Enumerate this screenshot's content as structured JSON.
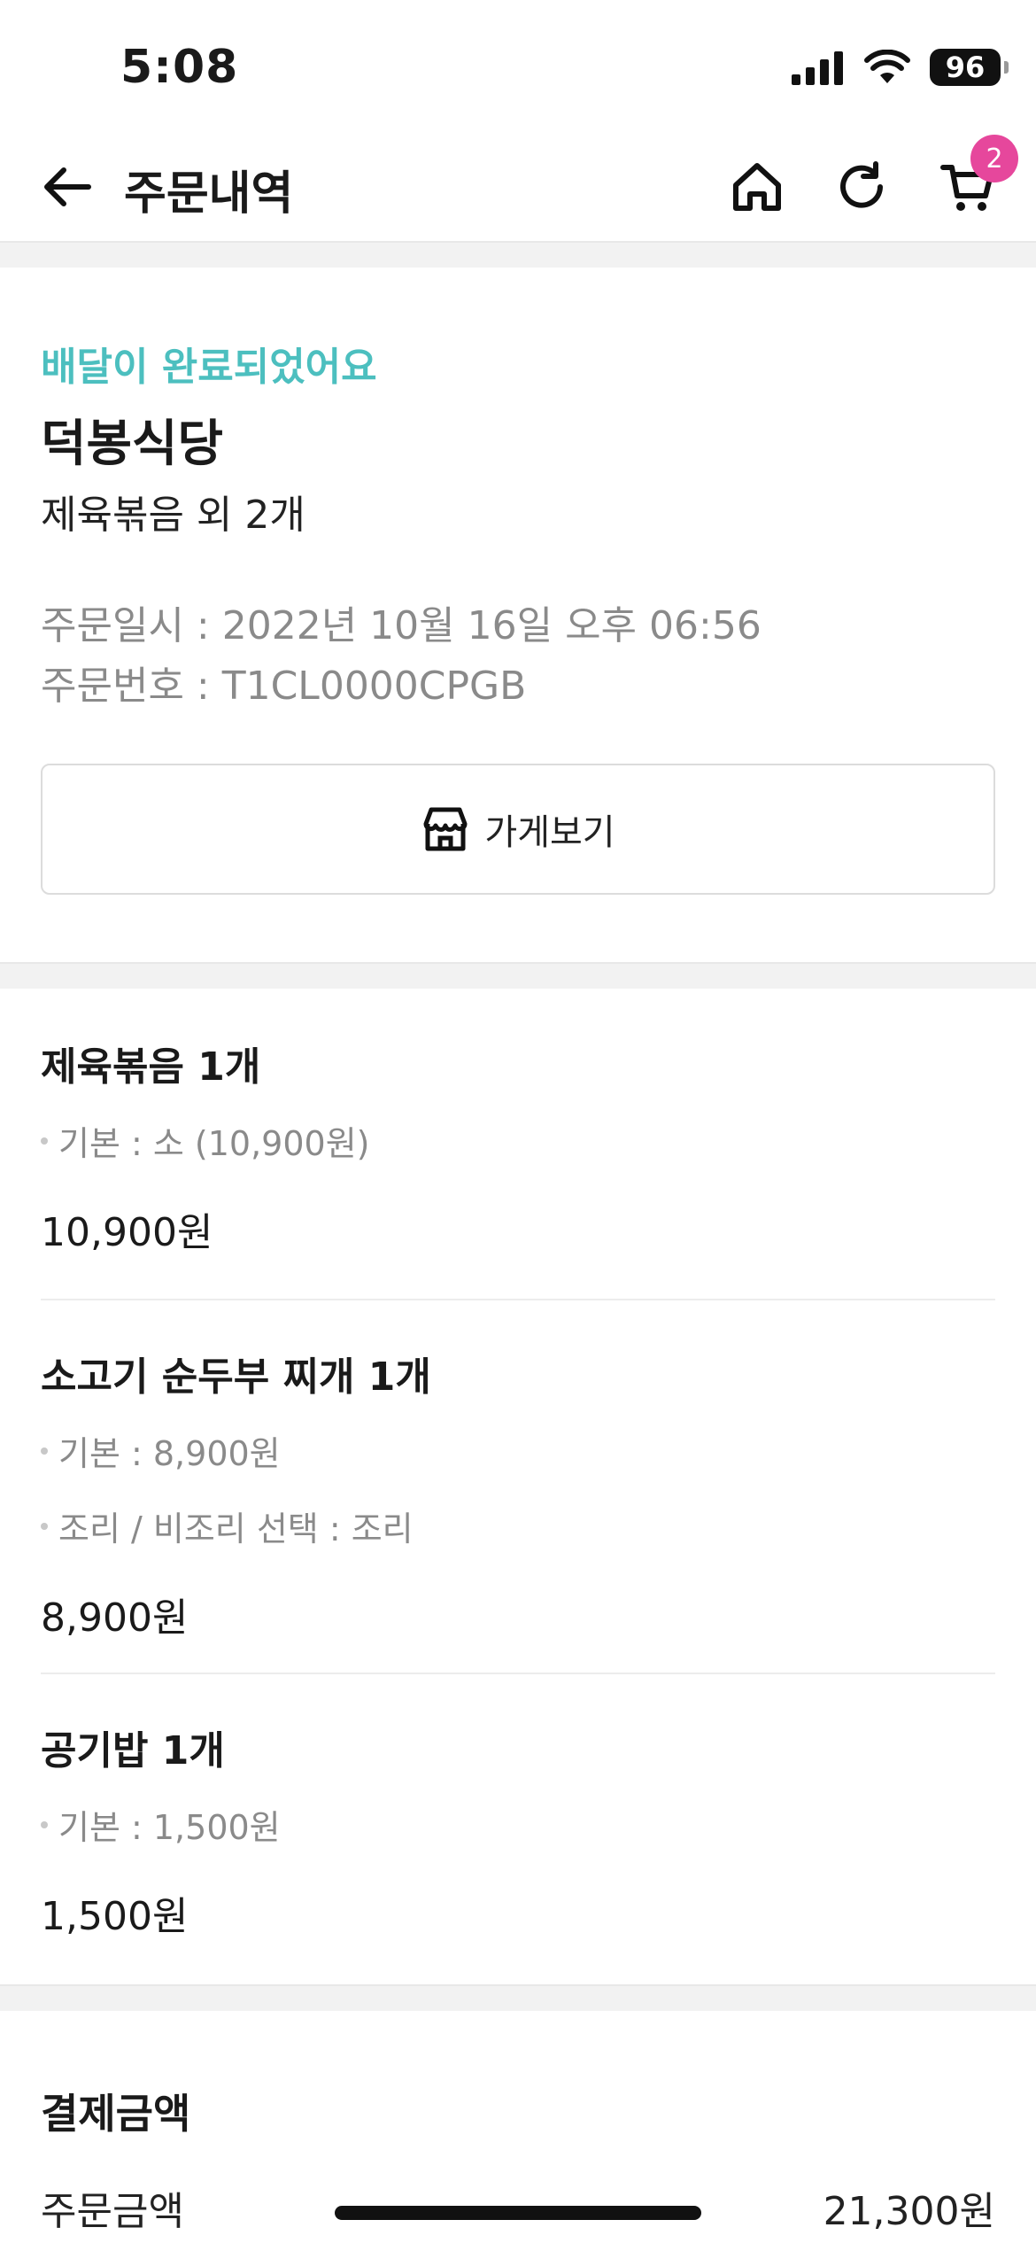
{
  "status_bar": {
    "time": "5:08",
    "battery": "96"
  },
  "nav": {
    "title": "주문내역",
    "cart_count": "2"
  },
  "order": {
    "status": "배달이 완료되었어요",
    "store_name": "덕봉식당",
    "summary": "제육볶음 외 2개",
    "date_line": "주문일시 : 2022년 10월 16일 오후 06:56",
    "number_line": "주문번호 : T1CL0000CPGB",
    "store_button_label": "가게보기"
  },
  "menu_items": [
    {
      "name": "제육볶음 1개",
      "options": [
        "기본 : 소 (10,900원)"
      ],
      "price": "10,900원"
    },
    {
      "name": "소고기 순두부 찌개 1개",
      "options": [
        "기본 : 8,900원",
        "조리 / 비조리 선택 : 조리"
      ],
      "price": "8,900원"
    },
    {
      "name": "공기밥 1개",
      "options": [
        "기본 : 1,500원"
      ],
      "price": "1,500원"
    }
  ],
  "payment": {
    "title": "결제금액",
    "order_amount_label": "주문금액",
    "order_amount_value": "21,300원"
  },
  "colors": {
    "status_accent": "#4cbfbf",
    "badge": "#e6479c"
  }
}
